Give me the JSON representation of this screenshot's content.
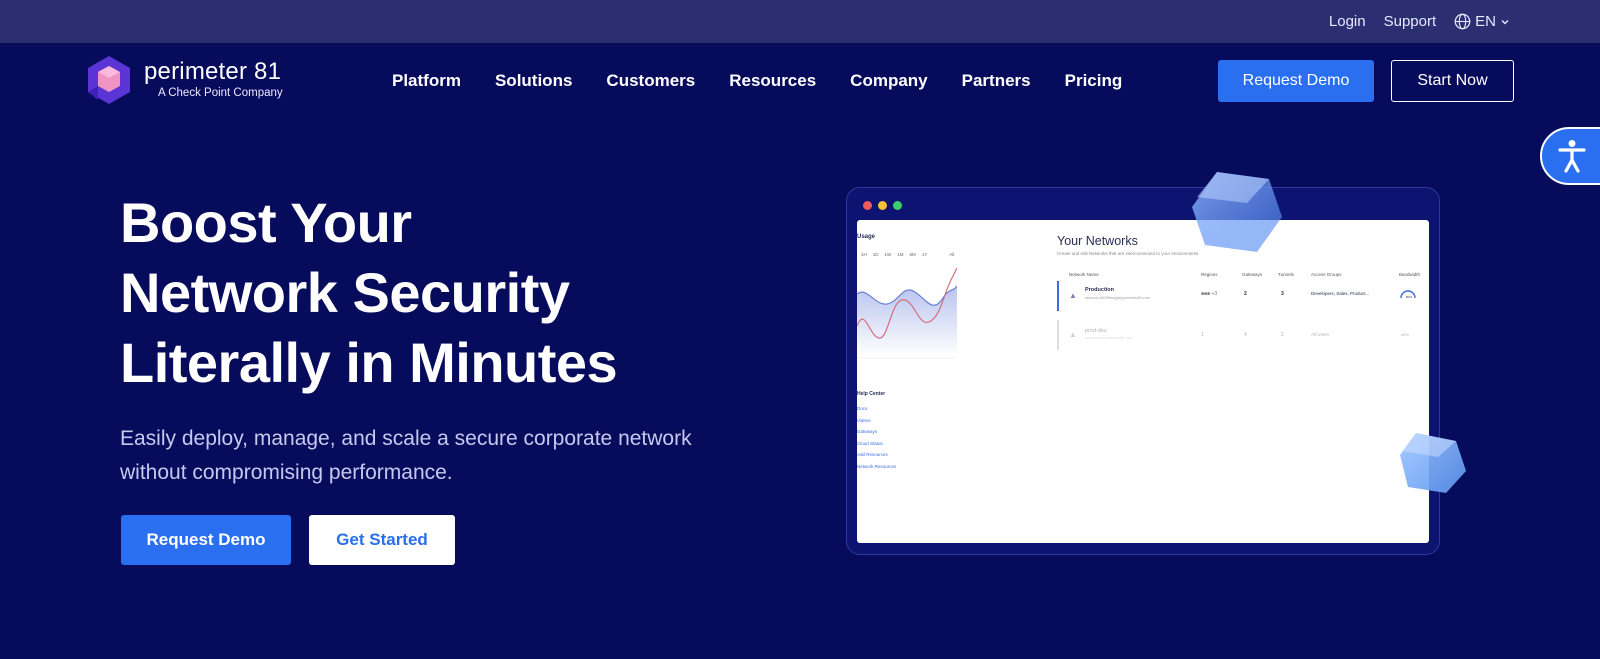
{
  "topbar": {
    "login": "Login",
    "support": "Support",
    "language": "EN"
  },
  "logo": {
    "name": "perimeter 81",
    "tagline": "A Check Point Company"
  },
  "nav": {
    "items": [
      {
        "label": "Platform"
      },
      {
        "label": "Solutions"
      },
      {
        "label": "Customers"
      },
      {
        "label": "Resources"
      },
      {
        "label": "Company"
      },
      {
        "label": "Partners"
      },
      {
        "label": "Pricing"
      }
    ],
    "request_demo": "Request Demo",
    "start_now": "Start Now"
  },
  "hero": {
    "title_line1": "Boost Your",
    "title_line2": "Network Security",
    "title_line3": "Literally in Minutes",
    "subtitle": "Easily deploy, manage, and scale a secure corporate network without compromising performance.",
    "request_demo": "Request Demo",
    "get_started": "Get Started"
  },
  "mockup": {
    "usage_label": "Usage",
    "ranges": [
      "1H",
      "1D",
      "1W",
      "1M",
      "6M",
      "1Y",
      "All"
    ],
    "help_label": "Help Center",
    "help_links": [
      "Docs",
      "Videos",
      "Gateways",
      "Cloud Status",
      "Add Resources",
      "Network Resources"
    ],
    "networks_title": "Your Networks",
    "networks_subtitle": "Create and edit Networks that are interconnected to your environments",
    "columns": [
      "Network Name",
      "Regions",
      "Gateways",
      "Tunnels",
      "Access Groups",
      "Bandwidth"
    ],
    "rows": [
      {
        "name": "Production",
        "subtitle": "www.net-1801ffbmygisly.perimeter81.com",
        "regions": "+3",
        "gateways": "2",
        "tunnels": "3",
        "groups": "Developers, Sales, Product...",
        "bandwidth": "80%"
      },
      {
        "name": "prod-des",
        "subtitle": "www.net-dev-perimeter81.com",
        "regions": "1",
        "gateways": "4",
        "tunnels": "2",
        "groups": "All Users",
        "bandwidth": "40%"
      }
    ]
  },
  "colors": {
    "background": "#070b5c",
    "topbar": "#2b2f72",
    "accent": "#2a6ff0",
    "logo_purple": "#5b34d6",
    "logo_pink": "#f093c4"
  },
  "icons": {
    "language": "globe-icon",
    "dropdown": "chevron-down-icon",
    "accessibility": "accessibility-icon"
  }
}
